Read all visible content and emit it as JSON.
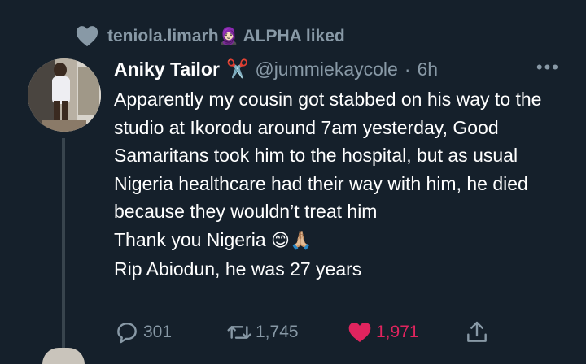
{
  "context": {
    "text": "teniola.limarh",
    "emoji": "🧕🏻",
    "suffix": "ALPHA liked"
  },
  "tweet": {
    "author_name": "Aniky Tailor",
    "author_badge": "✂️",
    "handle": "@jummiekaycole",
    "separator": "·",
    "time": "6h",
    "more_label": "•••",
    "lines": [
      "Apparently my cousin got stabbed on his way to the studio at Ikorodu around 7am yesterday, Good Samaritans took him to the hospital, but as usual Nigeria healthcare had their way with him, he died because they wouldn’t treat him",
      "Thank you Nigeria",
      "Rip Abiodun, he was 27 years"
    ],
    "thanks_emojis": "😊🙏🏼"
  },
  "actions": {
    "replies": "301",
    "retweets": "1,745",
    "likes": "1,971"
  },
  "colors": {
    "background": "#15202b",
    "secondary_text": "#8899a6",
    "like": "#e0245e",
    "thread_line": "#38444d"
  },
  "icons": {
    "context": "heart-icon",
    "reply": "comment-icon",
    "retweet": "retweet-icon",
    "like": "heart-filled-icon",
    "share": "share-icon",
    "more": "more-icon"
  }
}
